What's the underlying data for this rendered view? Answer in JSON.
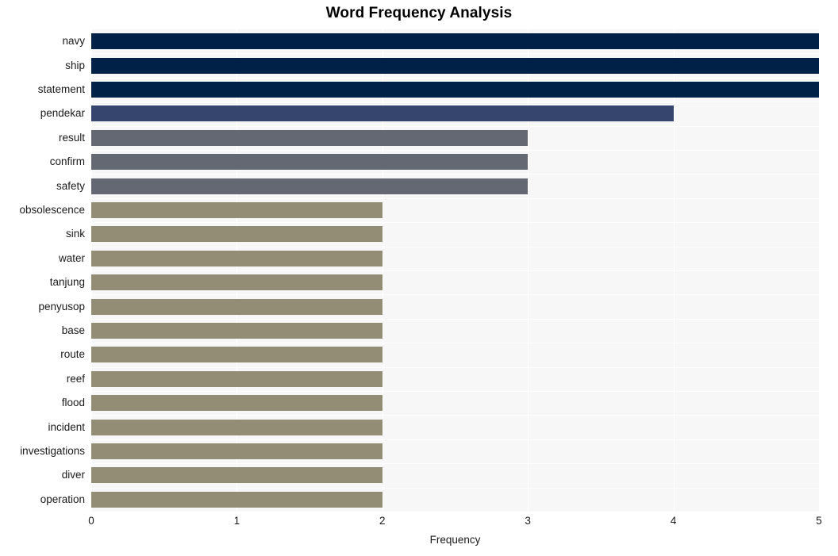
{
  "chart_data": {
    "type": "bar",
    "orientation": "horizontal",
    "title": "Word Frequency Analysis",
    "xlabel": "Frequency",
    "ylabel": "",
    "categories": [
      "navy",
      "ship",
      "statement",
      "pendekar",
      "result",
      "confirm",
      "safety",
      "obsolescence",
      "sink",
      "water",
      "tanjung",
      "penyusop",
      "base",
      "route",
      "reef",
      "flood",
      "incident",
      "investigations",
      "diver",
      "operation"
    ],
    "values": [
      5,
      5,
      5,
      4,
      3,
      3,
      3,
      2,
      2,
      2,
      2,
      2,
      2,
      2,
      2,
      2,
      2,
      2,
      2,
      2
    ],
    "bar_colors": [
      "#002147",
      "#002147",
      "#002147",
      "#36456e",
      "#646872",
      "#646872",
      "#646872",
      "#938d75",
      "#938d75",
      "#938d75",
      "#938d75",
      "#938d75",
      "#938d75",
      "#938d75",
      "#938d75",
      "#938d75",
      "#938d75",
      "#938d75",
      "#938d75",
      "#938d75"
    ],
    "xlim": [
      0,
      5
    ],
    "xticks": [
      0,
      1,
      2,
      3,
      4,
      5
    ],
    "xticklabels": [
      "0",
      "1",
      "2",
      "3",
      "4",
      "5"
    ],
    "grid": true,
    "grid_color": "#ffffff",
    "plot_background": "#f7f7f7",
    "figure_background": "#ffffff",
    "legend": null,
    "text_color": "#1a1a1a"
  }
}
